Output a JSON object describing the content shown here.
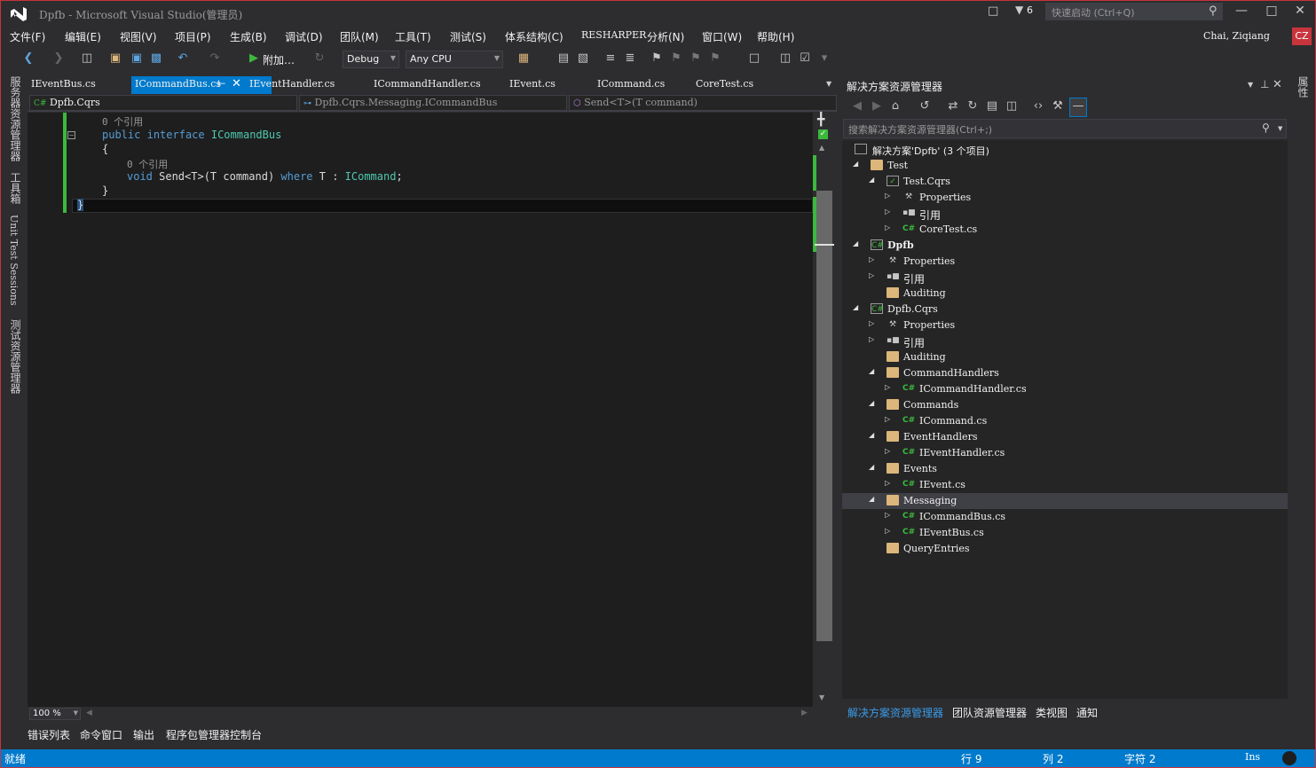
{
  "titlebar": {
    "title": "Dpfb - Microsoft Visual Studio(管理员)",
    "notification_count": "6",
    "quick_launch_placeholder": "快速启动 (Ctrl+Q)"
  },
  "menu": [
    "文件(F)",
    "编辑(E)",
    "视图(V)",
    "项目(P)",
    "生成(B)",
    "调试(D)",
    "团队(M)",
    "工具(T)",
    "测试(S)",
    "体系结构(C)",
    "RESHARPER",
    "分析(N)",
    "窗口(W)",
    "帮助(H)"
  ],
  "user": {
    "name": "Chai, Ziqiang",
    "initials": "CZ"
  },
  "toolbar": {
    "start_label": "附加…",
    "config": "Debug",
    "platform": "Any CPU"
  },
  "left_strip": [
    "服务器资源管理器",
    "工具箱",
    "Unit Test Sessions",
    "测试资源管理器"
  ],
  "doc_tabs": [
    "IEventBus.cs",
    "ICommandBus.cs",
    "IEventHandler.cs",
    "ICommandHandler.cs",
    "IEvent.cs",
    "ICommand.cs",
    "CoreTest.cs"
  ],
  "nav_bar": {
    "project": "Dpfb.Cqrs",
    "type": "Dpfb.Cqrs.Messaging.ICommandBus",
    "member": "Send<T>(T command)"
  },
  "code": {
    "lens1": "0 个引用",
    "line_interface_kw1": "public",
    "line_interface_kw2": "interface",
    "line_interface_name": "ICommandBus",
    "open_brace": "{",
    "lens2": "0 个引用",
    "method_void": "void",
    "method_sig": " Send<T>(T command) ",
    "method_where": "where",
    "method_constraint": " T : ",
    "method_type": "ICommand",
    "method_end": ";",
    "inner_close": "}",
    "outer_close": "}"
  },
  "zoom": "100 %",
  "bottom_tabs": [
    "错误列表",
    "命令窗口",
    "输出",
    "程序包管理器控制台"
  ],
  "solution_explorer": {
    "title": "解决方案资源管理器",
    "search_placeholder": "搜索解决方案资源管理器(Ctrl+;)",
    "tree": [
      {
        "label": "解决方案'Dpfb' (3 个项目)",
        "icon": "solution-icon"
      },
      {
        "label": "Test",
        "icon": "folder-icon"
      },
      {
        "label": "Test.Cqrs",
        "icon": "test-project-icon"
      },
      {
        "label": "Properties",
        "icon": "wrench-icon"
      },
      {
        "label": "引用",
        "icon": "references-icon"
      },
      {
        "label": "CoreTest.cs",
        "icon": "csharp-file-icon"
      },
      {
        "label": "Dpfb",
        "icon": "csharp-project-icon"
      },
      {
        "label": "Properties",
        "icon": "wrench-icon"
      },
      {
        "label": "引用",
        "icon": "references-icon"
      },
      {
        "label": "Auditing",
        "icon": "folder-icon"
      },
      {
        "label": "Dpfb.Cqrs",
        "icon": "csharp-project-icon"
      },
      {
        "label": "Properties",
        "icon": "wrench-icon"
      },
      {
        "label": "引用",
        "icon": "references-icon"
      },
      {
        "label": "Auditing",
        "icon": "folder-icon"
      },
      {
        "label": "CommandHandlers",
        "icon": "folder-icon"
      },
      {
        "label": "ICommandHandler.cs",
        "icon": "csharp-file-icon"
      },
      {
        "label": "Commands",
        "icon": "folder-icon"
      },
      {
        "label": "ICommand.cs",
        "icon": "csharp-file-icon"
      },
      {
        "label": "EventHandlers",
        "icon": "folder-icon"
      },
      {
        "label": "IEventHandler.cs",
        "icon": "csharp-file-icon"
      },
      {
        "label": "Events",
        "icon": "folder-icon"
      },
      {
        "label": "IEvent.cs",
        "icon": "csharp-file-icon"
      },
      {
        "label": "Messaging",
        "icon": "folder-icon"
      },
      {
        "label": "ICommandBus.cs",
        "icon": "csharp-file-icon"
      },
      {
        "label": "IEventBus.cs",
        "icon": "csharp-file-icon"
      },
      {
        "label": "QueryEntries",
        "icon": "folder-icon"
      }
    ],
    "tabs": [
      "解决方案资源管理器",
      "团队资源管理器",
      "类视图",
      "通知"
    ]
  },
  "right_strip": [
    "属性"
  ],
  "status": {
    "ready": "就绪",
    "line": "行 9",
    "col": "列 2",
    "ch": "字符 2",
    "mode": "Ins"
  },
  "colors": {
    "accent": "#007acc",
    "frame": "#c8343c",
    "editor_bg": "#1e1e1e",
    "keyword": "#569cd6",
    "type": "#4ec9b0"
  }
}
